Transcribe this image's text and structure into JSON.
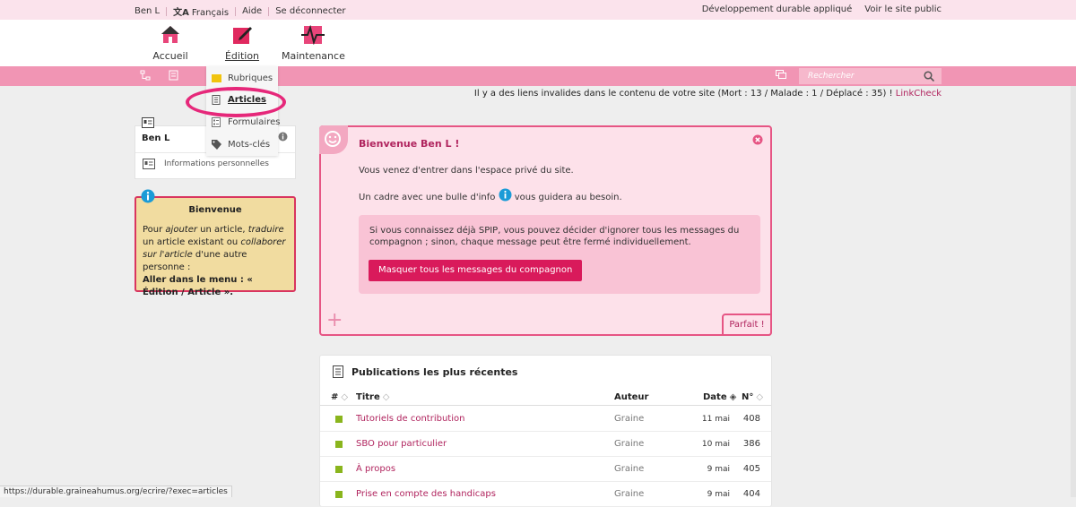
{
  "topbar": {
    "user": "Ben L",
    "language": "Français",
    "help": "Aide",
    "logout": "Se déconnecter",
    "site_name": "Développement durable appliqué",
    "view_site": "Voir le site public"
  },
  "nav": {
    "items": [
      {
        "label": "Accueil",
        "icon": "home-icon"
      },
      {
        "label": "Édition",
        "icon": "edit-icon"
      },
      {
        "label": "Maintenance",
        "icon": "maintenance-icon"
      }
    ]
  },
  "dropdown": {
    "items": [
      {
        "label": "Rubriques",
        "icon": "folder-icon"
      },
      {
        "label": "Articles",
        "icon": "article-icon"
      },
      {
        "label": "Formulaires",
        "icon": "form-icon"
      },
      {
        "label": "Mots-clés",
        "icon": "tag-icon"
      }
    ]
  },
  "search": {
    "placeholder": "Rechercher"
  },
  "alert": {
    "text": "Il y a des liens invalides dans le contenu de votre site (Mort : 13 / Malade : 1 / Déplacé : 35) ! ",
    "link": "LinkCheck"
  },
  "profile": {
    "name": "Ben L",
    "link": "Informations personnelles"
  },
  "help_box": {
    "title": "Bienvenue",
    "text_1": "Pour ",
    "text_ajouter": "ajouter",
    "text_2": " un article, ",
    "text_traduire": "traduire",
    "text_3": " un article existant ou ",
    "text_collaborer": "collaborer sur l'article",
    "text_4": " d'une autre personne :",
    "text_bold": "Aller dans le menu : « Édition / Article »."
  },
  "welcome": {
    "title": "Bienvenue Ben L !",
    "line1": "Vous venez d'entrer dans l'espace privé du site.",
    "line2a": "Un cadre avec une bulle d'info",
    "line2b": "vous guidera au besoin.",
    "inner_text": "Si vous connaissez déjà SPIP, vous pouvez décider d'ignorer tous les messages du compagnon ; sinon, chaque message peut être fermé individuellement.",
    "hide_button": "Masquer tous les messages du compagnon",
    "ok_button": "Parfait !"
  },
  "publications": {
    "title": "Publications les plus récentes",
    "columns": {
      "num": "#",
      "title": "Titre",
      "author": "Auteur",
      "date": "Date",
      "id": "N°"
    },
    "rows": [
      {
        "title": "Tutoriels de contribution",
        "author": "Graine",
        "date": "11 mai",
        "id": "408"
      },
      {
        "title": "SBO pour particulier",
        "author": "Graine",
        "date": "10 mai",
        "id": "386"
      },
      {
        "title": "À propos",
        "author": "Graine",
        "date": "9 mai",
        "id": "405"
      },
      {
        "title": "Prise en compte des handicaps",
        "author": "Graine",
        "date": "9 mai",
        "id": "404"
      }
    ]
  },
  "statusbar": {
    "url": "https://durable.graineahumus.org/ecrire/?exec=articles"
  },
  "colors": {
    "accent": "#d91a5b",
    "pink_bar": "#f195b4",
    "help_bg": "#f1dca0",
    "status_green": "#8ab51d"
  }
}
